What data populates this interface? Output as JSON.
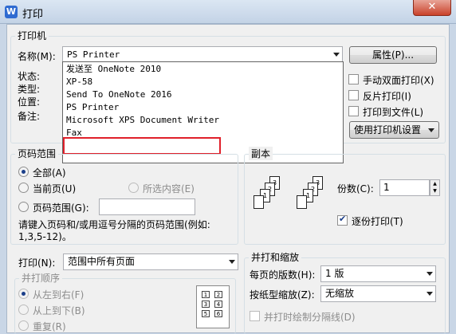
{
  "window": {
    "title": "打印",
    "close_label": "✕"
  },
  "printer": {
    "group_title": "打印机",
    "name_label": "名称(M):",
    "selected": "PS Printer",
    "properties_button": "属性(P)...",
    "status_label": "状态:",
    "type_label": "类型:",
    "location_label": "位置:",
    "comment_label": "备注:",
    "dropdown_items": [
      "发送至 OneNote 2010",
      "XP-58",
      "Send To OneNote 2016",
      "PS Printer",
      "Microsoft XPS Document Writer",
      "Fax"
    ],
    "duplex_label": "手动双面打印(X)",
    "reverse_label": "反片打印(I)",
    "print_to_file_label": "打印到文件(L)",
    "printer_settings": "使用打印机设置"
  },
  "page_range": {
    "group_title": "页码范围",
    "all_label": "全部(A)",
    "current_label": "当前页(U)",
    "selection_label": "所选内容(E)",
    "pages_label": "页码范围(G):",
    "pages_value": "",
    "hint_line1": "请键入页码和/或用逗号分隔的页码范围(例如:",
    "hint_line2": "1,3,5-12)。"
  },
  "copies": {
    "group_title": "副本",
    "count_label": "份数(C):",
    "count_value": "1",
    "collate_label": "逐份打印(T)"
  },
  "print_what": {
    "label": "打印(N):",
    "value": "范围中所有页面"
  },
  "order": {
    "group_title": "并打顺序",
    "left_right": "从左到右(F)",
    "top_bottom": "从上到下(B)",
    "repeat": "重复(R)"
  },
  "zoom": {
    "group_title": "并打和缩放",
    "pages_per_sheet_label": "每页的版数(H):",
    "pages_per_sheet_value": "1 版",
    "scale_label": "按纸型缩放(Z):",
    "scale_value": "无缩放",
    "divider_label": "并打时绘制分隔线(D)"
  }
}
